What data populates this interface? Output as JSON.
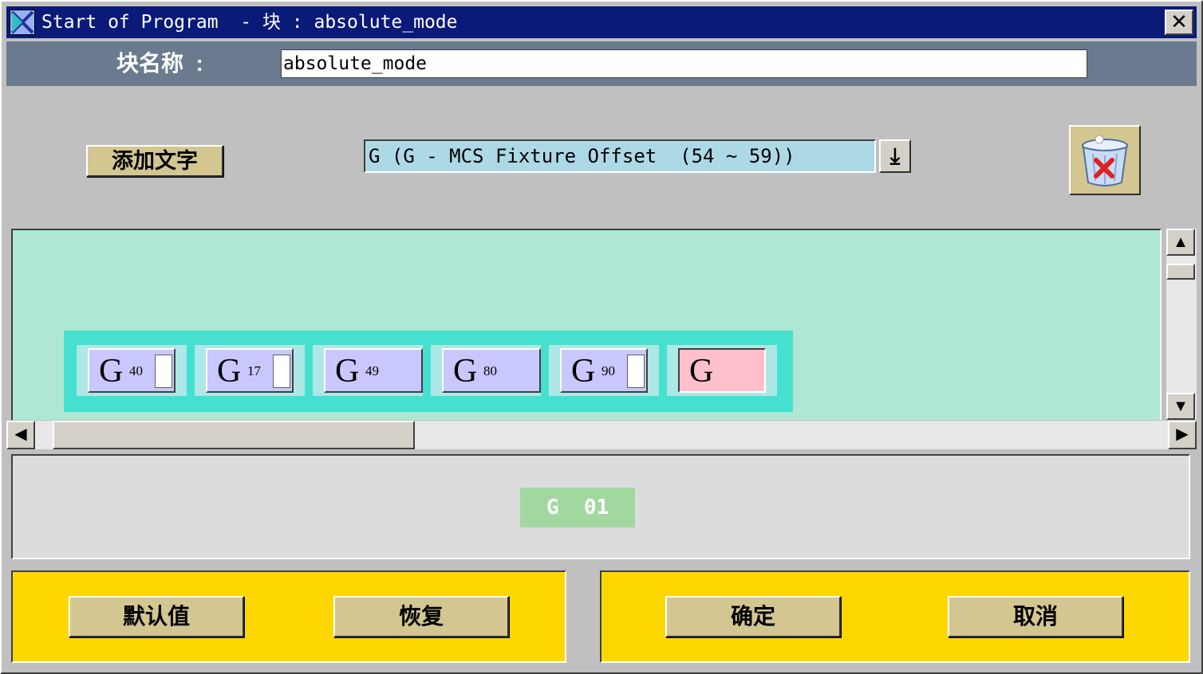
{
  "window": {
    "title": "Start of Program  - 块 : absolute_mode",
    "close_symbol": "✕"
  },
  "block_name": {
    "label": "块名称  :",
    "value": "absolute_mode"
  },
  "toolbar": {
    "add_text_label": "添加文字",
    "word_select_value": "G (G - MCS Fixture Offset  (54 ~ 59))",
    "dropdown_arrow": "⤓",
    "trash_icon": "trash-delete-icon"
  },
  "word_sequence": [
    {
      "letter": "G",
      "sub": "40",
      "has_box": true
    },
    {
      "letter": "G",
      "sub": "17",
      "has_box": true
    },
    {
      "letter": "G",
      "sub": "49",
      "has_box": false
    },
    {
      "letter": "G",
      "sub": "80",
      "has_box": false
    },
    {
      "letter": "G",
      "sub": "90",
      "has_box": true
    },
    {
      "letter": "G",
      "sub": "",
      "has_box": false,
      "selected": true
    }
  ],
  "scroll": {
    "up": "▲",
    "down": "▼",
    "left": "◀",
    "right": "▶"
  },
  "preview": {
    "tag": "G  01"
  },
  "buttons": {
    "default": "默认值",
    "restore": "恢复",
    "ok": "确定",
    "cancel": "取消"
  },
  "colors": {
    "title_bar": "#0a1a78",
    "work_area": "#aee8d2",
    "strip": "#45e0d0",
    "panel": "#ffd700",
    "selected_word": "#ffc0cc"
  }
}
